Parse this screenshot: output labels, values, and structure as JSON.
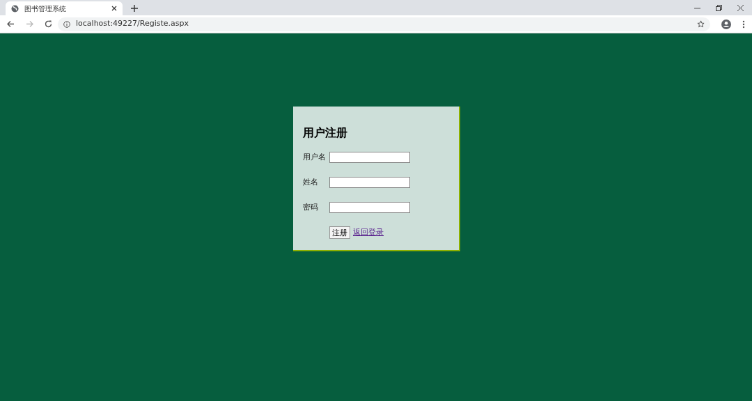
{
  "browser": {
    "tab_title": "图书管理系统",
    "url": "localhost:49227/Registe.aspx"
  },
  "form": {
    "title": "用户注册",
    "fields": [
      {
        "label": "用户名"
      },
      {
        "label": "姓名"
      },
      {
        "label": "密码"
      }
    ],
    "submit": "注册",
    "link": "返回登录"
  }
}
